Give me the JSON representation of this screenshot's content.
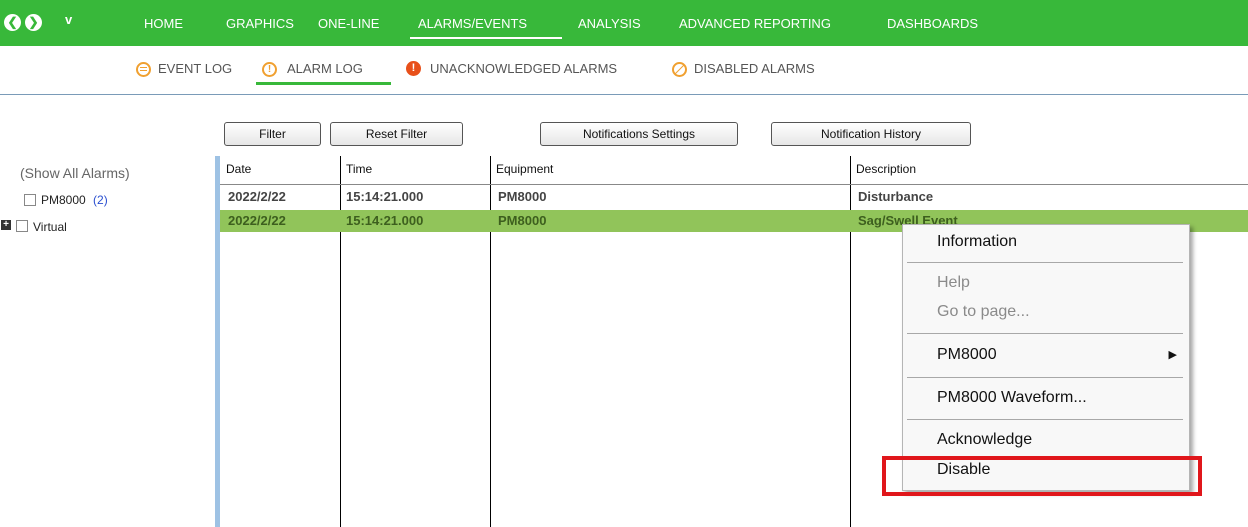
{
  "topnav": {
    "back_glyph": "❮",
    "forward_glyph": "❯",
    "dropdown_glyph": "v",
    "items": [
      "HOME",
      "GRAPHICS",
      "ONE-LINE",
      "ALARMS/EVENTS",
      "ANALYSIS",
      "ADVANCED REPORTING",
      "DASHBOARDS"
    ],
    "active": "ALARMS/EVENTS",
    "bg_color": "#38b83a"
  },
  "subnav": {
    "items": [
      {
        "label": "EVENT LOG",
        "icon": "list-icon",
        "color": "#f0a030"
      },
      {
        "label": "ALARM LOG",
        "icon": "alert-icon",
        "color": "#f0a030"
      },
      {
        "label": "UNACKNOWLEDGED ALARMS",
        "icon": "exclamation-icon",
        "color": "#e8501a"
      },
      {
        "label": "DISABLED ALARMS",
        "icon": "disabled-icon",
        "color": "#f0a030"
      }
    ],
    "active": "ALARM LOG",
    "alert_glyph": "!"
  },
  "toolbar": {
    "filter": "Filter",
    "reset_filter": "Reset Filter",
    "notifications_settings": "Notifications Settings",
    "notification_history": "Notification History"
  },
  "sidebar": {
    "show_all": "(Show All Alarms)",
    "items": [
      {
        "label": "PM8000",
        "count": "(2)"
      },
      {
        "label": "Virtual",
        "expander": "+"
      }
    ]
  },
  "table": {
    "columns": [
      "Date",
      "Time",
      "Equipment",
      "Description"
    ],
    "rows": [
      {
        "date": "2022/2/22",
        "time": "15:14:21.000",
        "equipment": "PM8000",
        "description": "Disturbance"
      },
      {
        "date": "2022/2/22",
        "time": "15:14:21.000",
        "equipment": "PM8000",
        "description": "Sag/Swell Event"
      }
    ],
    "selected_row": 1,
    "selected_color": "#91c45a"
  },
  "context_menu": {
    "items": [
      "Information",
      "Help",
      "Go to page...",
      "PM8000",
      "PM8000 Waveform...",
      "Acknowledge",
      "Disable"
    ],
    "submenu_arrow": "▶",
    "disabled_items": [
      "Help",
      "Go to page..."
    ],
    "highlighted_item": "Disable",
    "highlight_color": "#e0161b"
  }
}
